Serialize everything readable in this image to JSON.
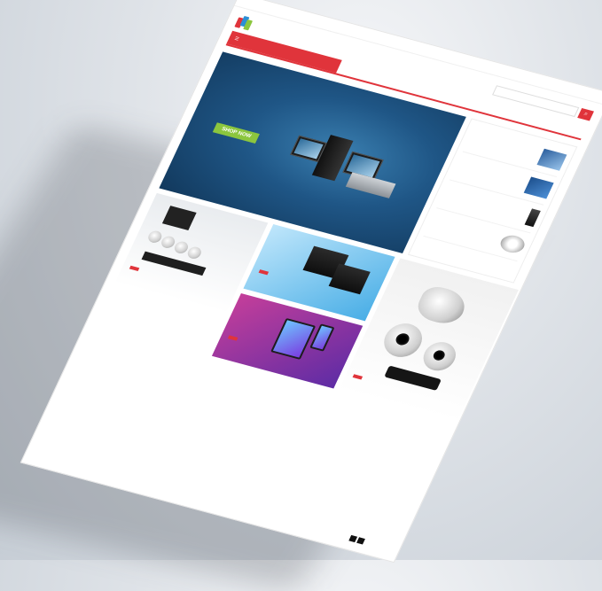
{
  "topbar": {
    "left": "",
    "right": [
      ""
    ]
  },
  "logo": {
    "text": ""
  },
  "search": {
    "placeholder": "",
    "button_icon": "search-icon"
  },
  "nav": {
    "categories_label": "",
    "items": [
      "",
      "",
      "",
      "",
      ""
    ]
  },
  "hero": {
    "text": "",
    "shop_button": "SHOP NOW"
  },
  "sidebar": {
    "items": [
      {
        "title": "",
        "price": ""
      },
      {
        "title": "",
        "price": ""
      },
      {
        "title": "",
        "price": ""
      },
      {
        "title": "",
        "price": ""
      }
    ]
  },
  "tiles": {
    "shop_now_label": ""
  },
  "footer": {
    "label": ""
  },
  "colors": {
    "accent": "#e0343b",
    "hero": "#1f5686",
    "button_green": "#8cc63e"
  }
}
